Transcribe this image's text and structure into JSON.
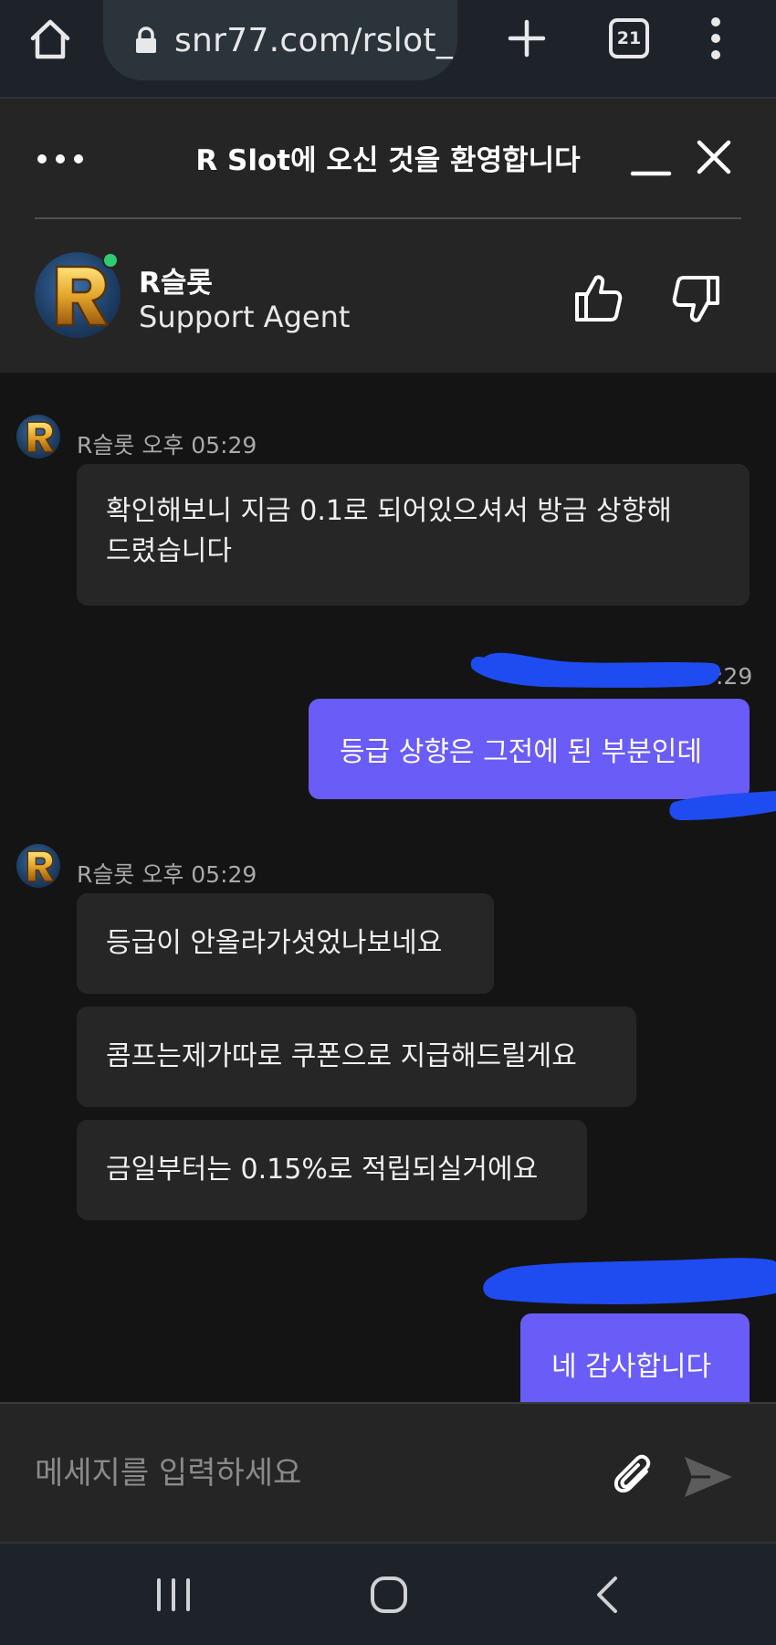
{
  "browser": {
    "url": "snr77.com/rslot_",
    "tab_count": "21",
    "icons": [
      "home-icon",
      "lock-icon",
      "plus-icon",
      "tabs-icon",
      "more-vert-icon"
    ]
  },
  "chat": {
    "title": "R Slot에 오신 것을 환영합니다",
    "agent": {
      "name": "R슬롯",
      "role": "Support Agent",
      "status": "online",
      "avatar_letter": "R"
    },
    "messages": [
      {
        "from": "agent",
        "meta": "R슬롯 오후 05:29",
        "bubbles": [
          "확인해보니 지금 0.1로 되어있으셔서 방금 상향해",
          "드렸습니다"
        ]
      },
      {
        "from": "user",
        "meta_time_fragment": ":29",
        "text": "등급 상향은 그전에 된 부분인데"
      },
      {
        "from": "agent",
        "meta": "R슬롯 오후 05:29",
        "bubbles": [
          "등급이 안올라가셧었나보네요",
          "콤프는제가따로 쿠폰으로 지급해드릴게요",
          "금일부터는 0.15%로 적립되실거에요"
        ]
      },
      {
        "from": "user",
        "text": "네 감사합니다"
      }
    ],
    "input_placeholder": "메세지를 입력하세요"
  },
  "colors": {
    "user_bubble": "#6a5cf6",
    "agent_bubble": "#262626",
    "background": "#141414",
    "header": "#252525",
    "online": "#2ecc71",
    "redaction": "#1f4cf0"
  }
}
